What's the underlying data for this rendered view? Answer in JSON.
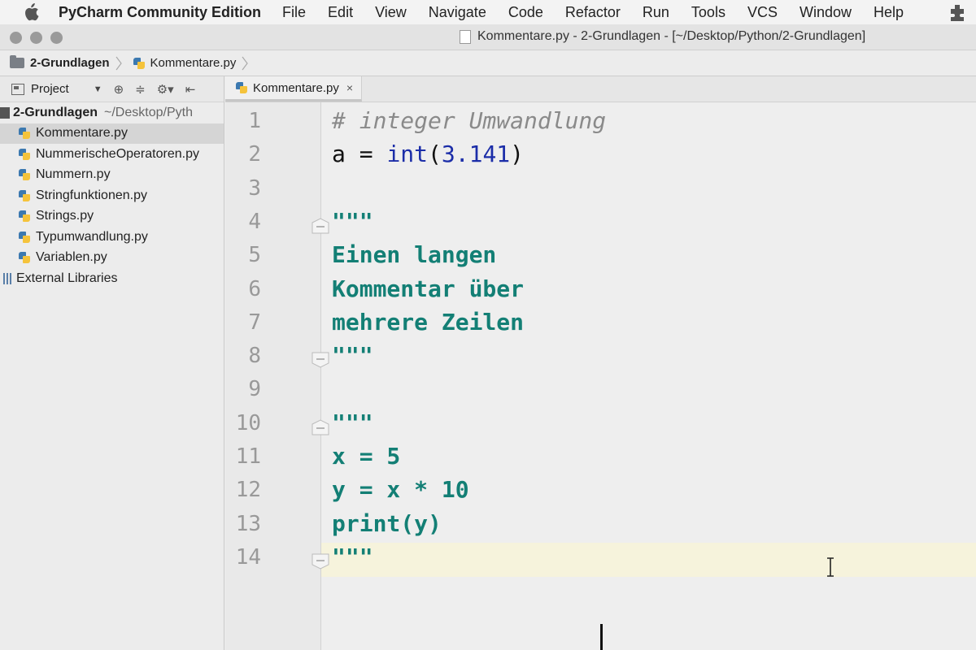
{
  "menubar": {
    "app_name": "PyCharm Community Edition",
    "items": [
      "File",
      "Edit",
      "View",
      "Navigate",
      "Code",
      "Refactor",
      "Run",
      "Tools",
      "VCS",
      "Window",
      "Help"
    ]
  },
  "window": {
    "title": "Kommentare.py - 2-Grundlagen - [~/Desktop/Python/2-Grundlagen]"
  },
  "breadcrumb": {
    "items": [
      "2-Grundlagen",
      "Kommentare.py"
    ]
  },
  "sidebar": {
    "toolbar_label": "Project",
    "root": {
      "name": "2-Grundlagen",
      "path": "~/Desktop/Pyth"
    },
    "files": [
      "Kommentare.py",
      "NummerischeOperatoren.py",
      "Nummern.py",
      "Stringfunktionen.py",
      "Strings.py",
      "Typumwandlung.py",
      "Variablen.py"
    ],
    "selected_index": 0,
    "external": "External Libraries"
  },
  "editor": {
    "tab_label": "Kommentare.py",
    "tab_close": "×",
    "line_numbers": [
      "1",
      "2",
      "3",
      "4",
      "5",
      "6",
      "7",
      "8",
      "9",
      "10",
      "11",
      "12",
      "13",
      "14"
    ],
    "current_line": 14,
    "lines": [
      [
        {
          "t": "# integer Umwandlung",
          "c": "comment"
        }
      ],
      [
        {
          "t": "a = ",
          "c": "plain"
        },
        {
          "t": "int",
          "c": "builtin"
        },
        {
          "t": "(",
          "c": "plain"
        },
        {
          "t": "3.141",
          "c": "number"
        },
        {
          "t": ")",
          "c": "plain"
        }
      ],
      [],
      [
        {
          "t": "\"\"\"",
          "c": "docstring"
        }
      ],
      [
        {
          "t": "Einen langen",
          "c": "docstring"
        }
      ],
      [
        {
          "t": "Kommentar über",
          "c": "docstring"
        }
      ],
      [
        {
          "t": "mehrere Zeilen",
          "c": "docstring"
        }
      ],
      [
        {
          "t": "\"\"\"",
          "c": "docstring"
        }
      ],
      [],
      [
        {
          "t": "\"\"\"",
          "c": "docstring"
        }
      ],
      [
        {
          "t": "x = 5",
          "c": "docstring"
        }
      ],
      [
        {
          "t": "y = x * 10",
          "c": "docstring"
        }
      ],
      [
        {
          "t": "print(y)",
          "c": "docstring"
        }
      ],
      [
        {
          "t": "\"\"\"",
          "c": "docstring"
        }
      ]
    ],
    "fold_lines": [
      4,
      8,
      10,
      14
    ]
  }
}
